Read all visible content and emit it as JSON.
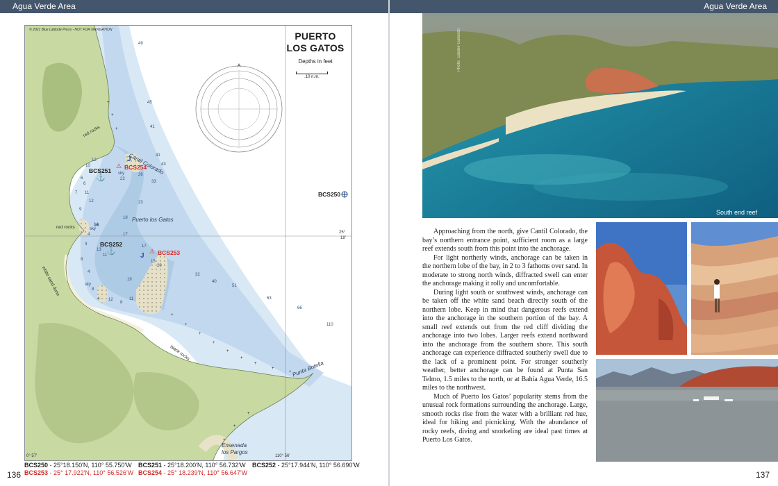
{
  "left_page": {
    "header": "Agua Verde Area",
    "page_number": "136",
    "chart": {
      "copyright": "© 2021 Blue Latitude Press - NOT FOR NAVIGATION",
      "title_line1": "PUERTO",
      "title_line2": "LOS GATOS",
      "units": "Depths in feet",
      "scale_label": ".10 n.m.",
      "waypoints_on_chart": {
        "bcs251": "BCS251",
        "bcs252": "BCS252",
        "bcs253": "BCS253",
        "bcs254": "BCS254",
        "bcs250": "BCS250"
      },
      "place_names": {
        "cantil_colorado": "Cantil Colorado",
        "puerto_los_gatos": "Puerto los Gatos",
        "punta_botella": "Punta Botella",
        "ensenada_line1": "Ensenada",
        "ensenada_line2": "los Pargos"
      },
      "land_labels": {
        "red_rocks_north": "red rocks",
        "red_rocks_middle": "red rocks",
        "white_sand_dune": "white sand dune",
        "black_rocks": "black rocks",
        "sky_1": "sky",
        "sky_2": "sky",
        "sky_3": "sky"
      },
      "lat_labels": {
        "lat_deg": "25°",
        "lat_min": "18'",
        "lon_left": "0° 57'",
        "lon_right": "110° 56'"
      },
      "soundings": [
        "49",
        "45",
        "41",
        "41",
        "43",
        "26",
        "33",
        "23",
        "22",
        "18",
        "17",
        "17",
        "15",
        "20",
        "19",
        "32",
        "40",
        "51",
        "63",
        "66",
        "110",
        "10",
        "12",
        "6",
        "7",
        "11",
        "9",
        "14",
        "12",
        "6",
        "4",
        "11",
        "4",
        "8",
        "4",
        "13",
        "54",
        "8",
        "4",
        "12",
        "8",
        "11"
      ]
    },
    "waypoint_table": {
      "row1": [
        {
          "id": "BCS250",
          "coords": " - 25°18.150'N, 110° 55.750'W",
          "red": false
        },
        {
          "id": "BCS251",
          "coords": " - 25°18.200'N, 110° 56.732'W",
          "red": false
        },
        {
          "id": "BCS252",
          "coords": " - 25°17.944'N, 110° 56.690'W",
          "red": false
        }
      ],
      "row2": [
        {
          "id": "BCS253",
          "coords": " - 25° 17.922'N, 110° 56.526'W",
          "red": true
        },
        {
          "id": "BCS254",
          "coords": " - 25° 18.239'N, 110° 56.647'W",
          "red": true
        }
      ]
    }
  },
  "right_page": {
    "header": "Agua Verde Area",
    "page_number": "137",
    "photo_credit": "Photo: Sabine Gallardo",
    "main_photo_caption": "South end reef",
    "paragraphs": [
      "Approaching from the north, give Cantil Colorado, the bay’s northern entrance point, sufficient room as a large reef extends south from this point into the anchorage.",
      "For light northerly winds, anchorage can be taken in the northern lobe of the bay, in 2 to 3 fathoms over sand. In moderate to strong north winds, diffracted swell can enter the anchorage making it rolly and uncomfortable.",
      "During light south or southwest winds, anchorage can be taken off the white sand beach directly south of the northern lobe. Keep in mind that dangerous reefs extend into the anchorage in the southern portion of the bay. A small reef extends out from the red cliff dividing the anchorage into two lobes. Larger reefs extend northward into the anchorage from the southern shore. This south anchorage can experience diffracted southerly swell due to the lack of a prominent point. For stronger southerly weather, better anchorage can be found at Punta San Telmo, 1.5 miles to the north, or at Bahía Agua Verde, 16.5 miles to the northwest.",
      "Much of Puerto los Gatos’ popularity stems from the unusual rock formations surrounding the anchorage. Large, smooth rocks rise from the water with a brilliant red hue, ideal for hiking and picnicking. With the abundance of rocky reefs, diving and snorkeling are ideal past times at Puerto Los Gatos."
    ]
  }
}
